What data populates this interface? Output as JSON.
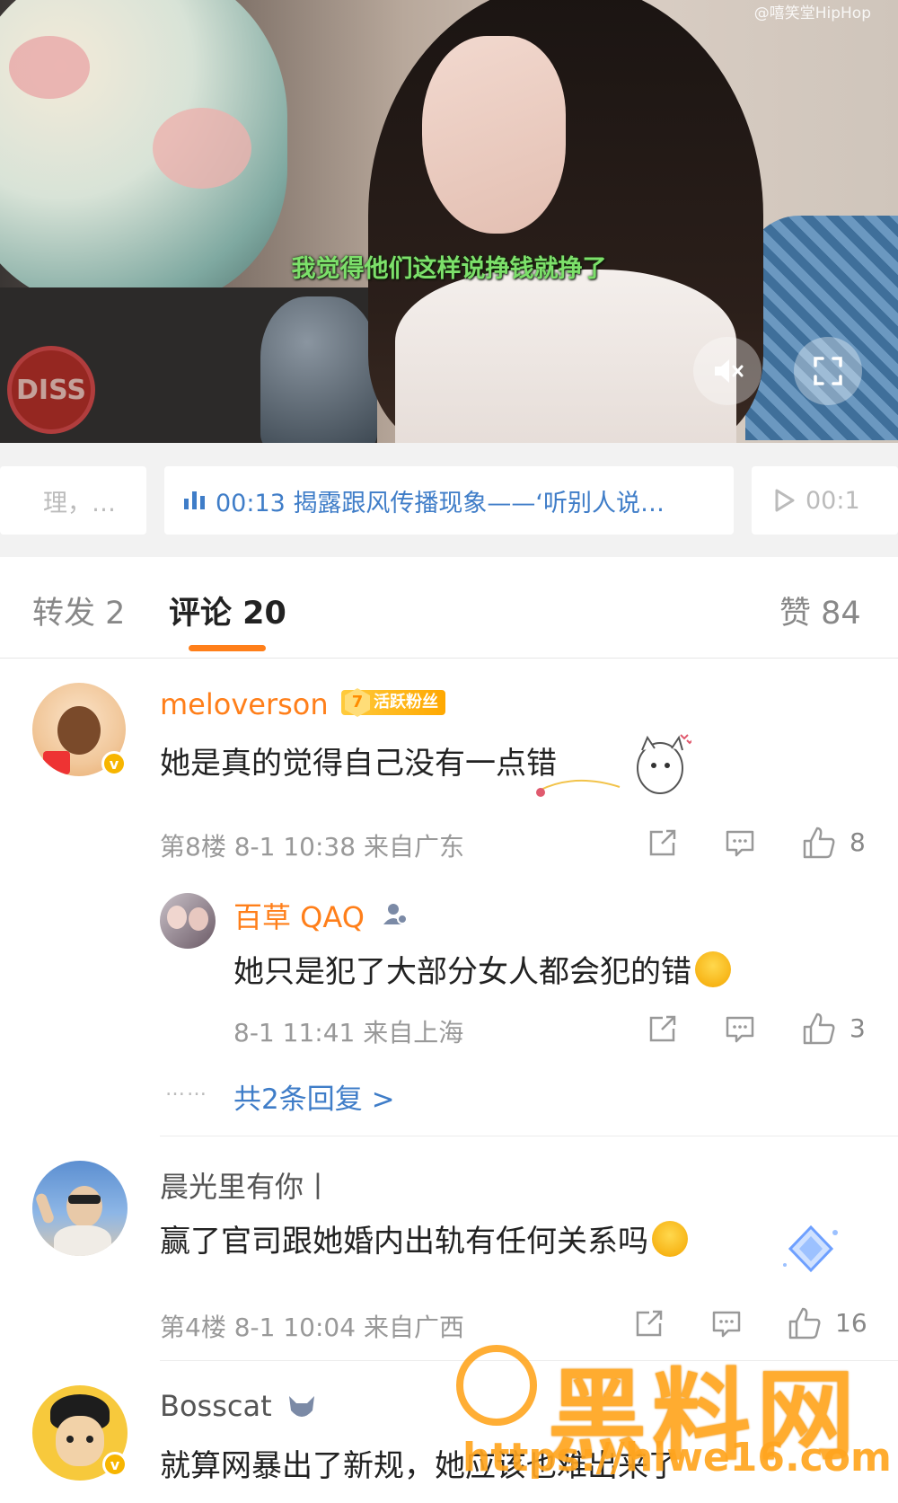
{
  "video": {
    "source_tag": "@嘻笑堂HipHop",
    "subtitle": "我觉得他们这样说挣钱就挣了",
    "channel_logo_text": "DISS"
  },
  "chapters": {
    "prev": "理，…",
    "current": "00:13 揭露跟风传播现象——‘听别人说…",
    "next": "00:1"
  },
  "tabs": {
    "repost": "转发 2",
    "comments": "评论 20",
    "likes": "赞 84"
  },
  "comments": [
    {
      "user": "meloverson",
      "fan_level": "7",
      "fan_badge": "活跃粉丝",
      "text": "她是真的觉得自己没有一点错",
      "meta": "第8楼  8-1 10:38  来自广东",
      "likes": "8",
      "reply": {
        "user": "百草 QAQ",
        "text": "她只是犯了大部分女人都会犯的错",
        "meta": "8-1 11:41  来自上海",
        "likes": "3"
      },
      "more_dots": "……",
      "more_replies": "共2条回复 >"
    },
    {
      "user": "晨光里有你丨",
      "text": "赢了官司跟她婚内出轨有任何关系吗",
      "meta": "第4楼  8-1 10:04  来自广西",
      "likes": "16"
    },
    {
      "user": "Bosscat",
      "text": "就算网暴出了新规，她应该也难出来了"
    }
  ],
  "watermark": {
    "cn": "黑料网",
    "url": "https://hlwe16.com"
  },
  "colors": {
    "accent": "#ff7f1a",
    "link": "#3f7dc8",
    "subtitle": "#7ce06a"
  }
}
